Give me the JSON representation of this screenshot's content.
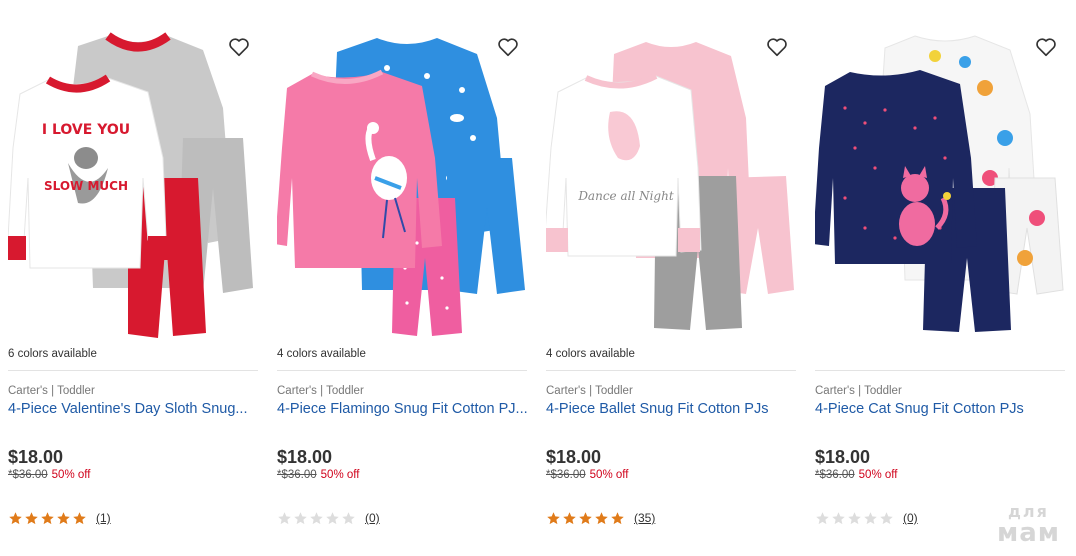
{
  "products": [
    {
      "colors": "6 colors available",
      "brand": "Carter's | Toddler",
      "title": "4-Piece Valentine's Day Sloth Snug...",
      "price": "$18.00",
      "original_price": "*$36.00",
      "discount": "50% off",
      "rating": 5,
      "reviews": "(1)",
      "shirt_text_1": "I LOVE YOU",
      "shirt_text_2": "SLOW MUCH",
      "accent": "#d7192f"
    },
    {
      "colors": "4 colors available",
      "brand": "Carter's | Toddler",
      "title": "4-Piece Flamingo Snug Fit Cotton PJ...",
      "price": "$18.00",
      "original_price": "*$36.00",
      "discount": "50% off",
      "rating": 0,
      "reviews": "(0)",
      "accent": "#f36fa0"
    },
    {
      "colors": "4 colors available",
      "brand": "Carter's | Toddler",
      "title": "4-Piece Ballet Snug Fit Cotton PJs",
      "price": "$18.00",
      "original_price": "*$36.00",
      "discount": "50% off",
      "rating": 5,
      "reviews": "(35)",
      "shirt_text_1": "Dance all Night",
      "accent": "#f6b8c8"
    },
    {
      "colors": "",
      "brand": "Carter's | Toddler",
      "title": "4-Piece Cat Snug Fit Cotton PJs",
      "price": "$18.00",
      "original_price": "*$36.00",
      "discount": "50% off",
      "rating": 0,
      "reviews": "(0)",
      "accent": "#1c2760"
    }
  ],
  "colors": {
    "title_link": "#1f5aa6",
    "discount": "#d0021b",
    "star_filled": "#e07b1a",
    "star_empty": "#dddddd"
  },
  "watermark": {
    "line1": "для",
    "line2": "мам"
  }
}
